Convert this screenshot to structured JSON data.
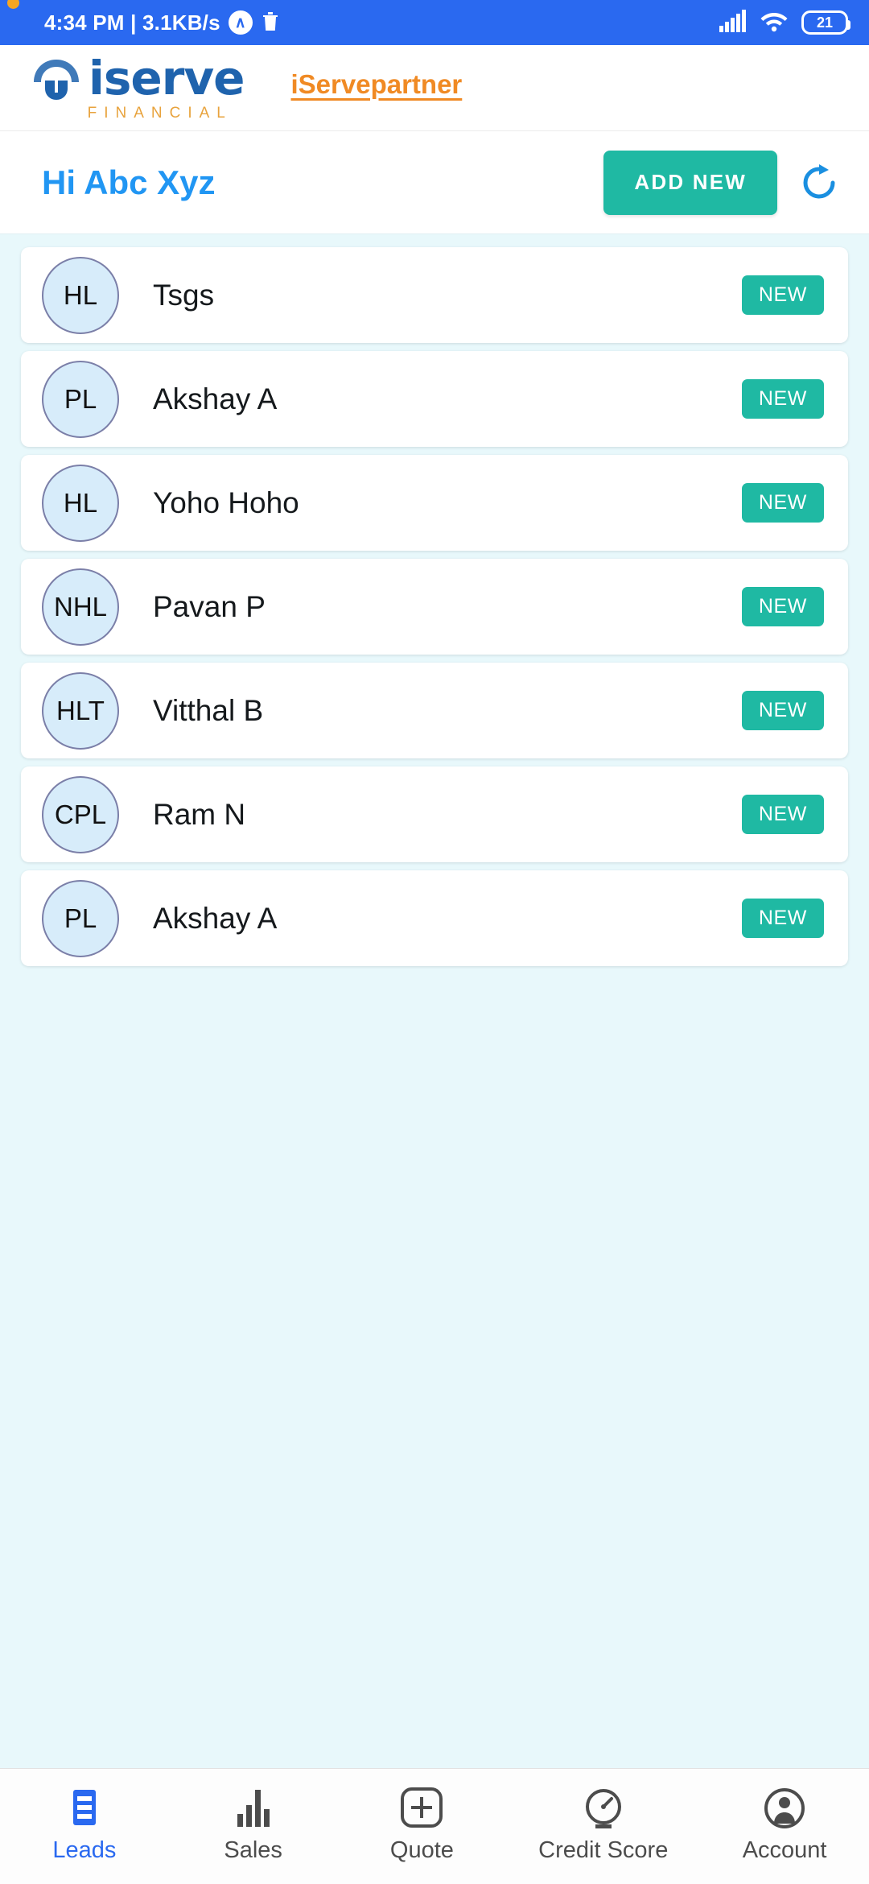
{
  "status_bar": {
    "clock": "4:34 PM | 3.1KB/s",
    "app_badge": "∧",
    "trash_icon": "trash-icon",
    "signal_icon": "cellular-signal-icon",
    "wifi_icon": "wifi-icon",
    "battery_level": "21"
  },
  "header": {
    "logo_text": "iserve",
    "logo_subtitle": "FINANCIAL",
    "brand_link": "iServepartner"
  },
  "greeting": {
    "text": "Hi Abc Xyz",
    "add_new_label": "ADD NEW",
    "refresh_icon": "refresh-icon"
  },
  "leads": [
    {
      "initials": "HL",
      "name": "Tsgs",
      "status": "NEW"
    },
    {
      "initials": "PL",
      "name": "Akshay A",
      "status": "NEW"
    },
    {
      "initials": "HL",
      "name": "Yoho Hoho",
      "status": "NEW"
    },
    {
      "initials": "NHL",
      "name": "Pavan P",
      "status": "NEW"
    },
    {
      "initials": "HLT",
      "name": "Vitthal B",
      "status": "NEW"
    },
    {
      "initials": "CPL",
      "name": "Ram N",
      "status": "NEW"
    },
    {
      "initials": "PL",
      "name": "Akshay A",
      "status": "NEW"
    }
  ],
  "bottom_nav": [
    {
      "label": "Leads",
      "icon": "list-icon",
      "active": true
    },
    {
      "label": "Sales",
      "icon": "bar-chart-icon",
      "active": false
    },
    {
      "label": "Quote",
      "icon": "plus-box-icon",
      "active": false
    },
    {
      "label": "Credit Score",
      "icon": "gauge-icon",
      "active": false
    },
    {
      "label": "Account",
      "icon": "person-icon",
      "active": false
    }
  ],
  "colors": {
    "status_bar_blue": "#2a69f0",
    "accent_teal": "#1fb9a3",
    "brand_orange": "#f08a24",
    "logo_blue": "#1f63ad",
    "greeting_blue": "#2196f3",
    "page_background": "#e8f8fb",
    "avatar_fill": "#d7ecfa",
    "avatar_border": "#7b7fa8"
  }
}
